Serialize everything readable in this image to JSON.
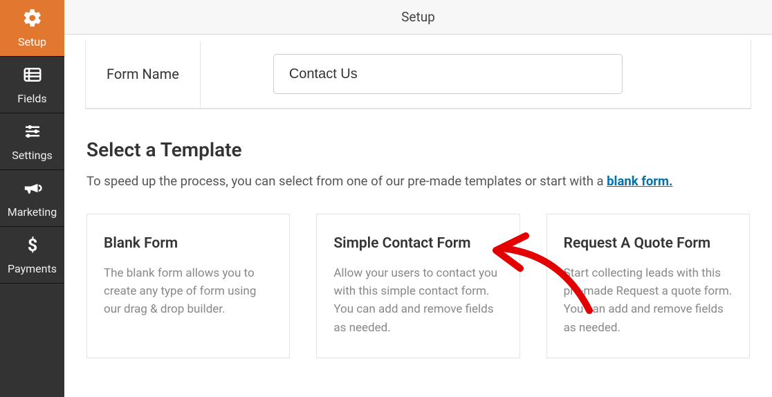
{
  "topbar": {
    "title": "Setup"
  },
  "sidebar": {
    "items": [
      {
        "label": "Setup"
      },
      {
        "label": "Fields"
      },
      {
        "label": "Settings"
      },
      {
        "label": "Marketing"
      },
      {
        "label": "Payments"
      }
    ]
  },
  "form_name": {
    "label": "Form Name",
    "value": "Contact Us"
  },
  "templates": {
    "heading": "Select a Template",
    "intro_pre": "To speed up the process, you can select from one of our pre-made templates or start with a ",
    "intro_link": "blank form.",
    "cards": [
      {
        "title": "Blank Form",
        "desc": "The blank form allows you to create any type of form using our drag & drop builder."
      },
      {
        "title": "Simple Contact Form",
        "desc": "Allow your users to contact you with this simple contact form. You can add and remove fields as needed."
      },
      {
        "title": "Request A Quote Form",
        "desc": "Start collecting leads with this pre-made Request a quote form. You can add and remove fields as needed."
      }
    ]
  }
}
